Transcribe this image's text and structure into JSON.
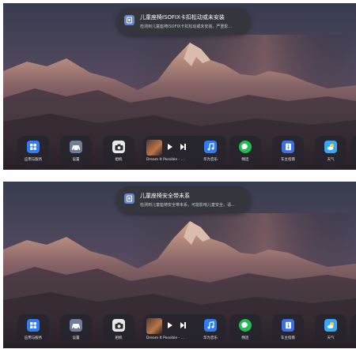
{
  "screens": [
    {
      "notification": {
        "title": "儿童座椅ISOFIX卡扣松动或未安装",
        "message": "检测到儿童座椅ISOFIX卡扣松动或未安装。严重影..."
      }
    },
    {
      "notification": {
        "title": "儿童座椅安全带未系",
        "message": "检测到儿童座椅安全带未系，可能影响儿童安全。请..."
      }
    }
  ],
  "dock": {
    "apps_label": "应用与服务",
    "settings_label": "设置",
    "camera_label": "相机",
    "now_playing": "Dream It Possible - ...",
    "music_label": "华为音乐",
    "chat_label": "畅连",
    "manual_label": "车主指南",
    "weather_label": "天气"
  },
  "colors": {
    "apps_icon": "#2f7cf6",
    "settings_icon": "#6f7e9a",
    "camera_icon": "#2b2b2b",
    "music_icon": "#2d7cf7",
    "chat_icon": "#1fbe53",
    "manual_icon": "#3c6fe0",
    "weather_icon": "#36a8f5"
  }
}
